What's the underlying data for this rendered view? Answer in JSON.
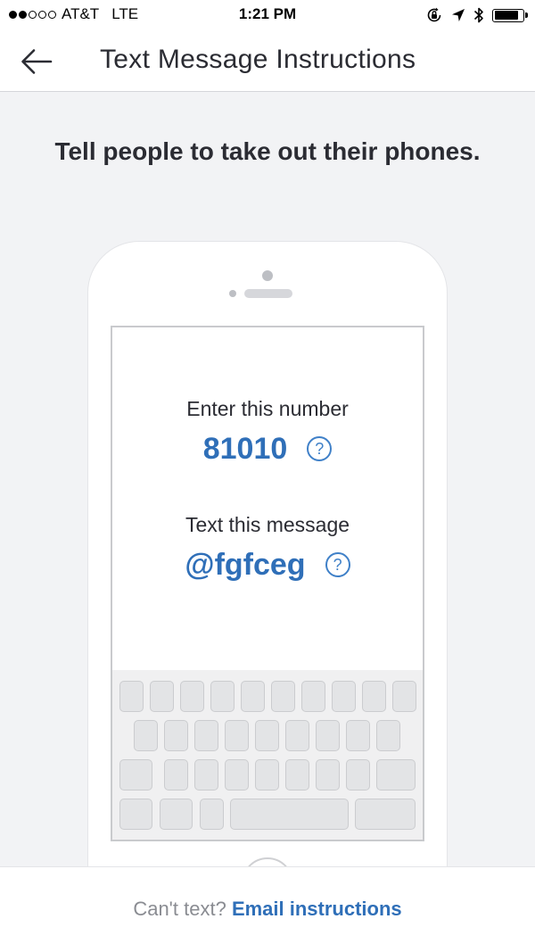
{
  "status_bar": {
    "carrier": "AT&T",
    "network": "LTE",
    "time": "1:21 PM",
    "signal_bars_filled": 2,
    "signal_bars_total": 5,
    "battery_level": 0.84,
    "icons": [
      "orientation-lock-icon",
      "location-arrow-icon",
      "bluetooth-icon",
      "battery-icon"
    ]
  },
  "nav": {
    "title": "Text Message Instructions",
    "back_icon": "arrow-left-icon"
  },
  "headline": "Tell people to take out their phones.",
  "instructions": {
    "number_label": "Enter this number",
    "number": "81010",
    "message_label": "Text this message",
    "message": "@fgfceg",
    "help_glyph": "?"
  },
  "footer": {
    "prompt": "Can't text?",
    "link": "Email instructions"
  },
  "colors": {
    "accent": "#2f6fb8",
    "background": "#f2f3f5",
    "text": "#2b2c33",
    "muted": "#8a8c92"
  }
}
